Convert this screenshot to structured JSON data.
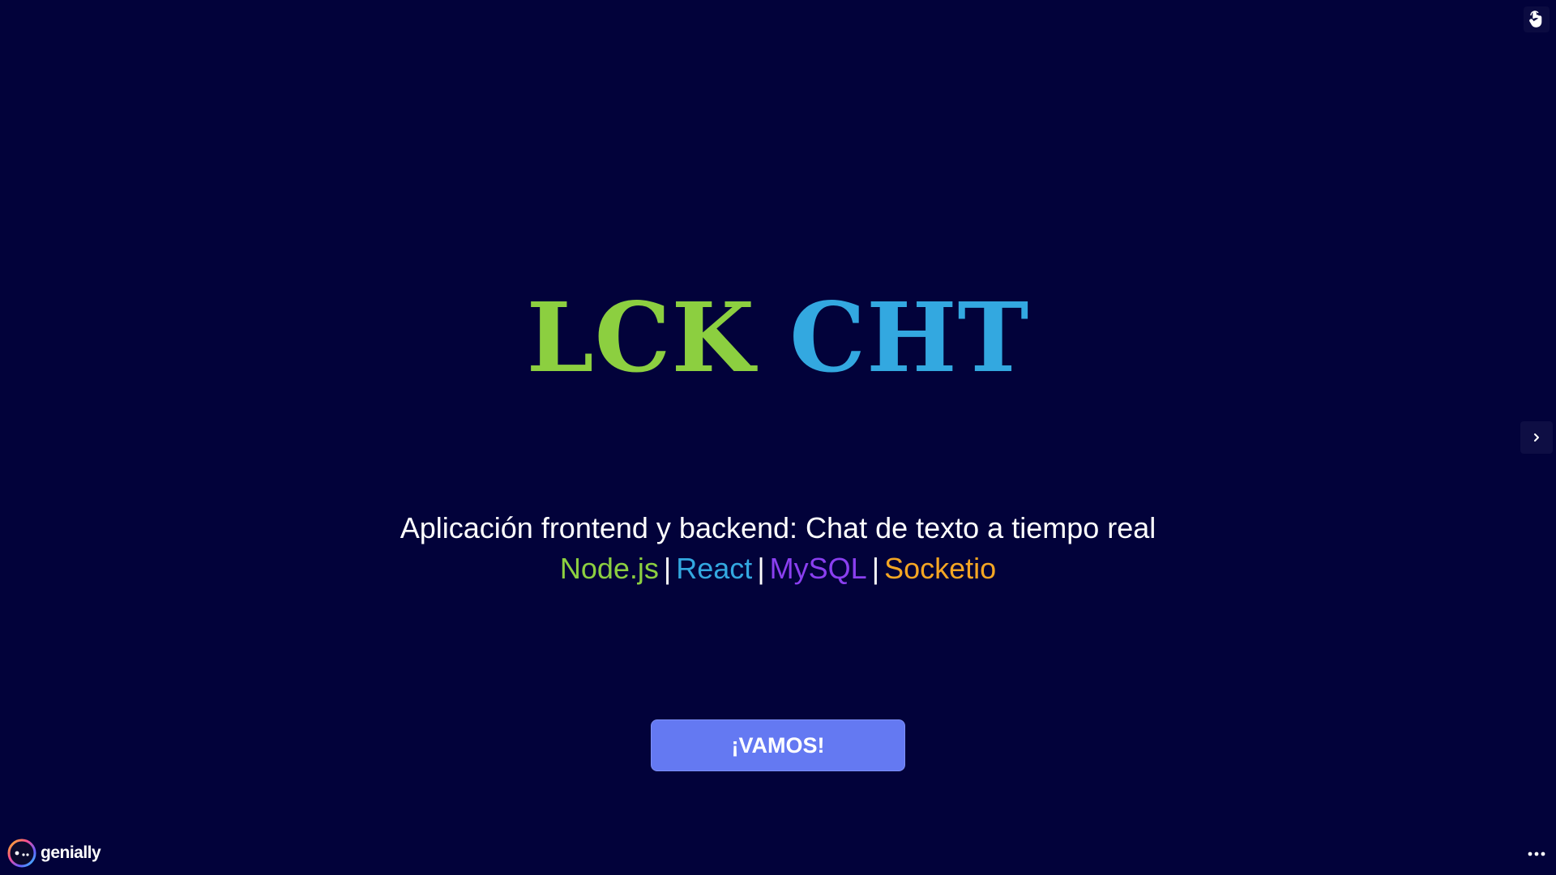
{
  "title": {
    "word1": "LCK",
    "word2": "CHT",
    "color1": "#8ccf40",
    "color2": "#33a8e0"
  },
  "subtitle": "Aplicación frontend y backend: Chat de texto a tiempo real",
  "tech": [
    {
      "label": "Node.js",
      "color": "#8ccf40"
    },
    {
      "label": "React",
      "color": "#33a8e0"
    },
    {
      "label": "MySQL",
      "color": "#8a3ff0"
    },
    {
      "label": "Socketio",
      "color": "#f5a623"
    }
  ],
  "separator": "|",
  "cta": {
    "label": "¡VAMOS!",
    "color": "#6479f2"
  },
  "brand": {
    "name": "genially"
  },
  "icons": {
    "top_right": "hand-pointer-icon",
    "next": "chevron-right-icon",
    "more": "more-dots-icon",
    "brand": "genially-logo-icon"
  },
  "background": "#02023a"
}
